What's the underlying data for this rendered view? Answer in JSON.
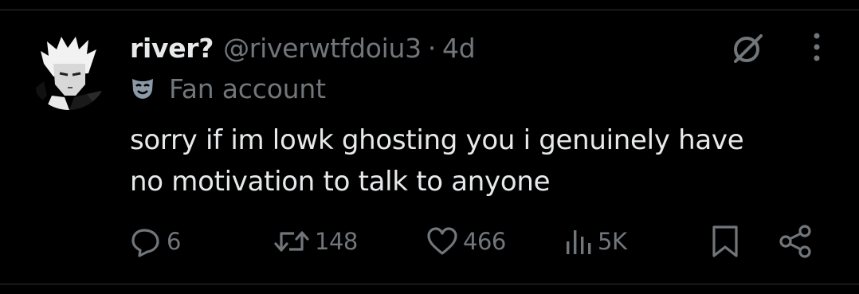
{
  "tweet": {
    "display_name": "river?",
    "handle": "@riverwtfdoiu3",
    "separator": "·",
    "time": "4d",
    "label": "Fan account",
    "text_lines": [
      "sorry if im lowk ghosting you i genuinely have",
      "no motivation to talk to anyone"
    ],
    "icons": {
      "grok": "grok-icon",
      "more": "more-icon",
      "label": "mask-icon"
    }
  },
  "actions": {
    "reply": {
      "count": "6",
      "icon": "reply-icon"
    },
    "retweet": {
      "count": "148",
      "icon": "retweet-icon"
    },
    "like": {
      "count": "466",
      "icon": "heart-icon"
    },
    "views": {
      "count": "5K",
      "icon": "views-icon"
    },
    "bookmark": {
      "icon": "bookmark-icon"
    },
    "share": {
      "icon": "share-icon"
    }
  },
  "colors": {
    "background": "#000000",
    "primary_text": "#e7e9ea",
    "secondary_text": "#71767b",
    "divider": "#2f3336",
    "label_icon": "#8b98a5"
  }
}
